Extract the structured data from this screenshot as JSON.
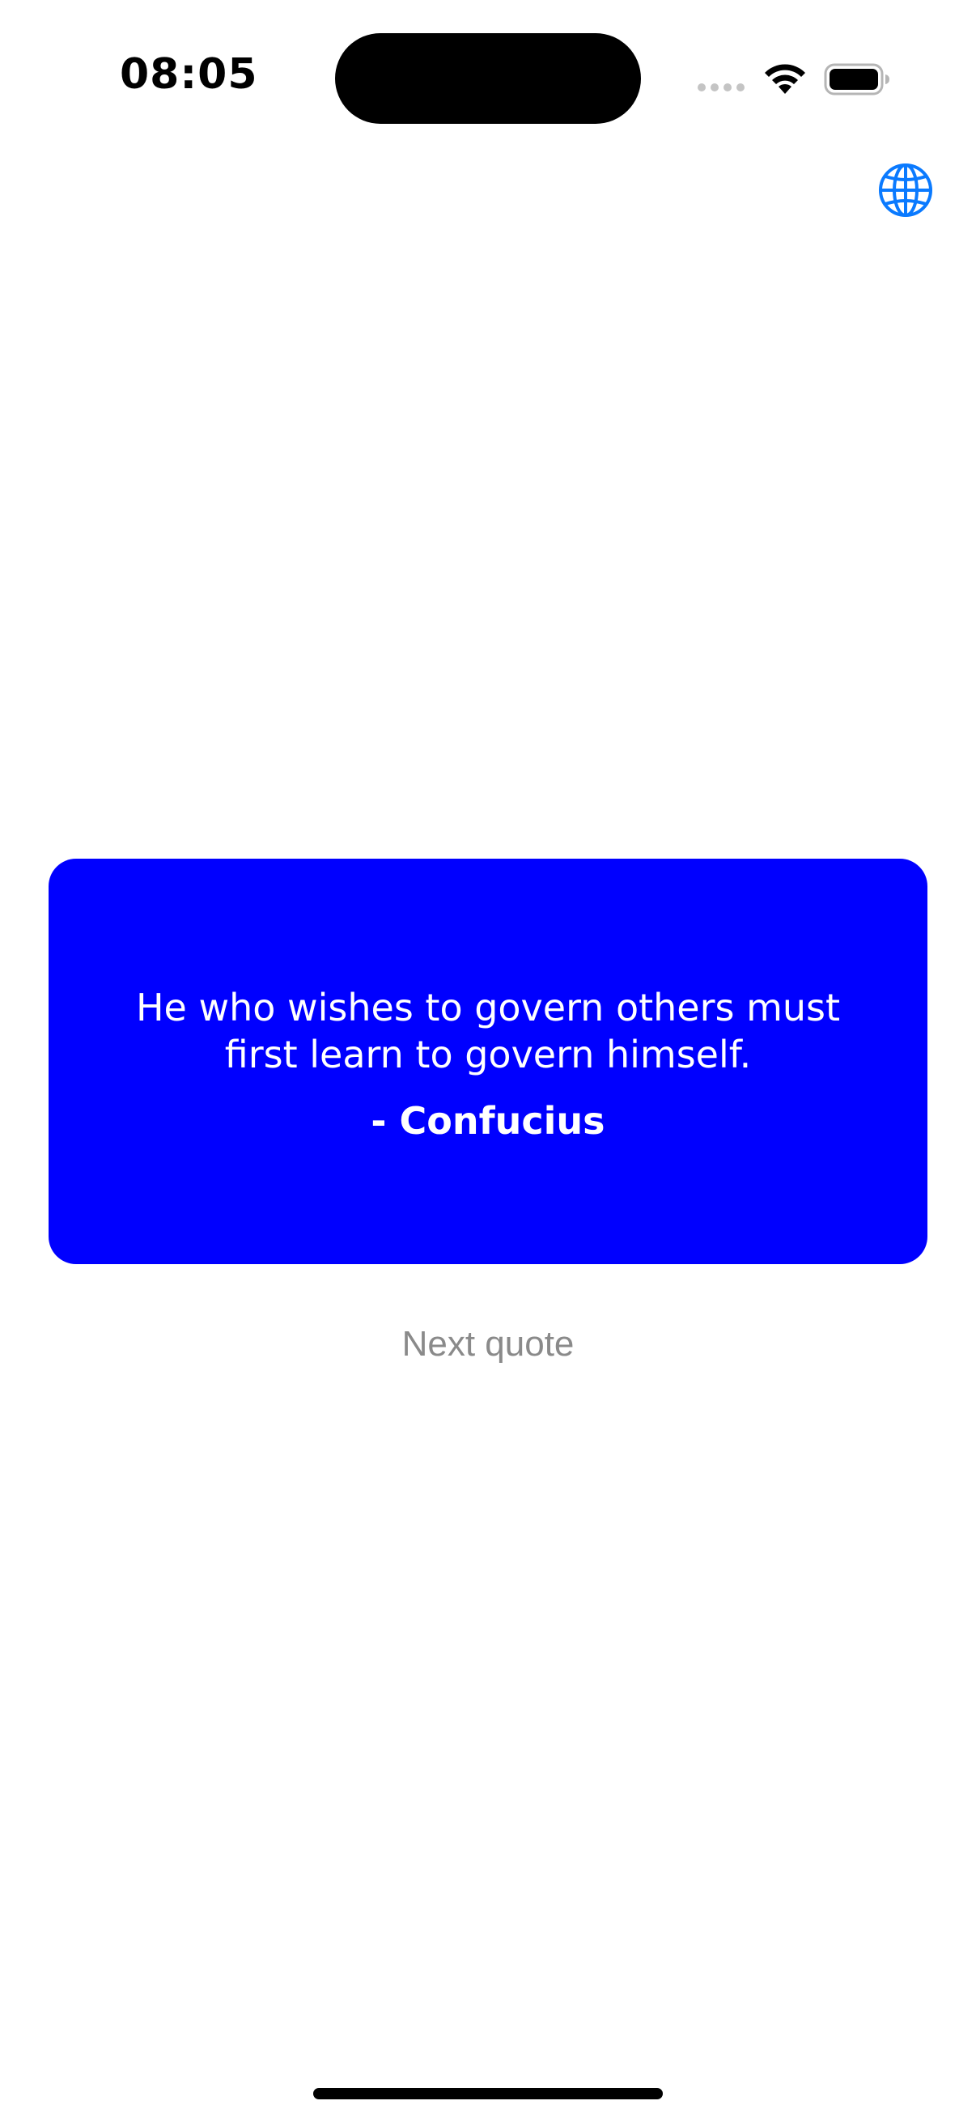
{
  "status_bar": {
    "time": "08:05",
    "icons": [
      "cellular-dots-icon",
      "wifi-icon",
      "battery-icon"
    ]
  },
  "toolbar": {
    "language_icon": "globe-icon",
    "accent_color": "#0a7aff"
  },
  "quote": {
    "text": "He who wishes to govern others must first learn to govern himself.",
    "author": "- Confucius",
    "card_color": "#0000ff"
  },
  "actions": {
    "next_label": "Next quote"
  }
}
